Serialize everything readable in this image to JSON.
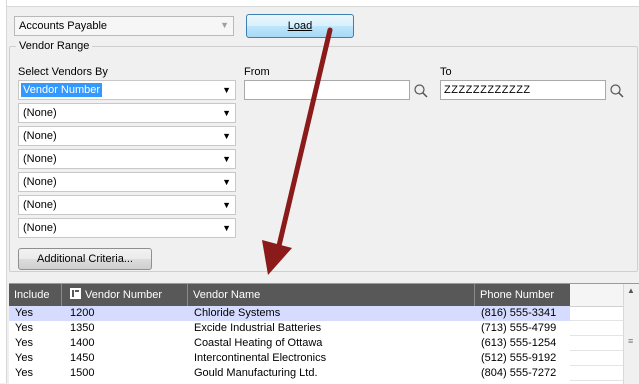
{
  "module": {
    "value": "Accounts Payable"
  },
  "toolbar": {
    "load_prefix": "",
    "load_key": "L",
    "load_rest": "oad"
  },
  "vendor_range": {
    "title": "Vendor Range",
    "select_by_label": "Select Vendors By",
    "from_label": "From",
    "to_label": "To",
    "from_value": "",
    "to_value": "ZZZZZZZZZZZZ",
    "selectors": [
      "Vendor Number",
      "(None)",
      "(None)",
      "(None)",
      "(None)",
      "(None)",
      "(None)"
    ],
    "additional_button": "Additional Criteria..."
  },
  "grid": {
    "headers": [
      "Include",
      "Vendor Number",
      "Vendor Name",
      "Phone Number"
    ],
    "rows": [
      {
        "include": "Yes",
        "number": "1200",
        "name": "Chloride Systems",
        "phone": "(816) 555-3341"
      },
      {
        "include": "Yes",
        "number": "1350",
        "name": "Excide Industrial Batteries",
        "phone": "(713) 555-4799"
      },
      {
        "include": "Yes",
        "number": "1400",
        "name": "Coastal Heating of Ottawa",
        "phone": "(613) 555-1254"
      },
      {
        "include": "Yes",
        "number": "1450",
        "name": "Intercontinental Electronics",
        "phone": "(512) 555-9192"
      },
      {
        "include": "Yes",
        "number": "1500",
        "name": "Gould Manufacturing Ltd.",
        "phone": "(804) 555-7272"
      }
    ]
  },
  "colors": {
    "accent_arrow": "#8b1a1a",
    "selected_row": "#d6dcff",
    "header_bg": "#585858",
    "highlight": "#3399ff"
  },
  "icons": {
    "lookup": "magnifier-icon",
    "dropdown": "chevron-down-icon",
    "column": "column-chooser-icon"
  }
}
